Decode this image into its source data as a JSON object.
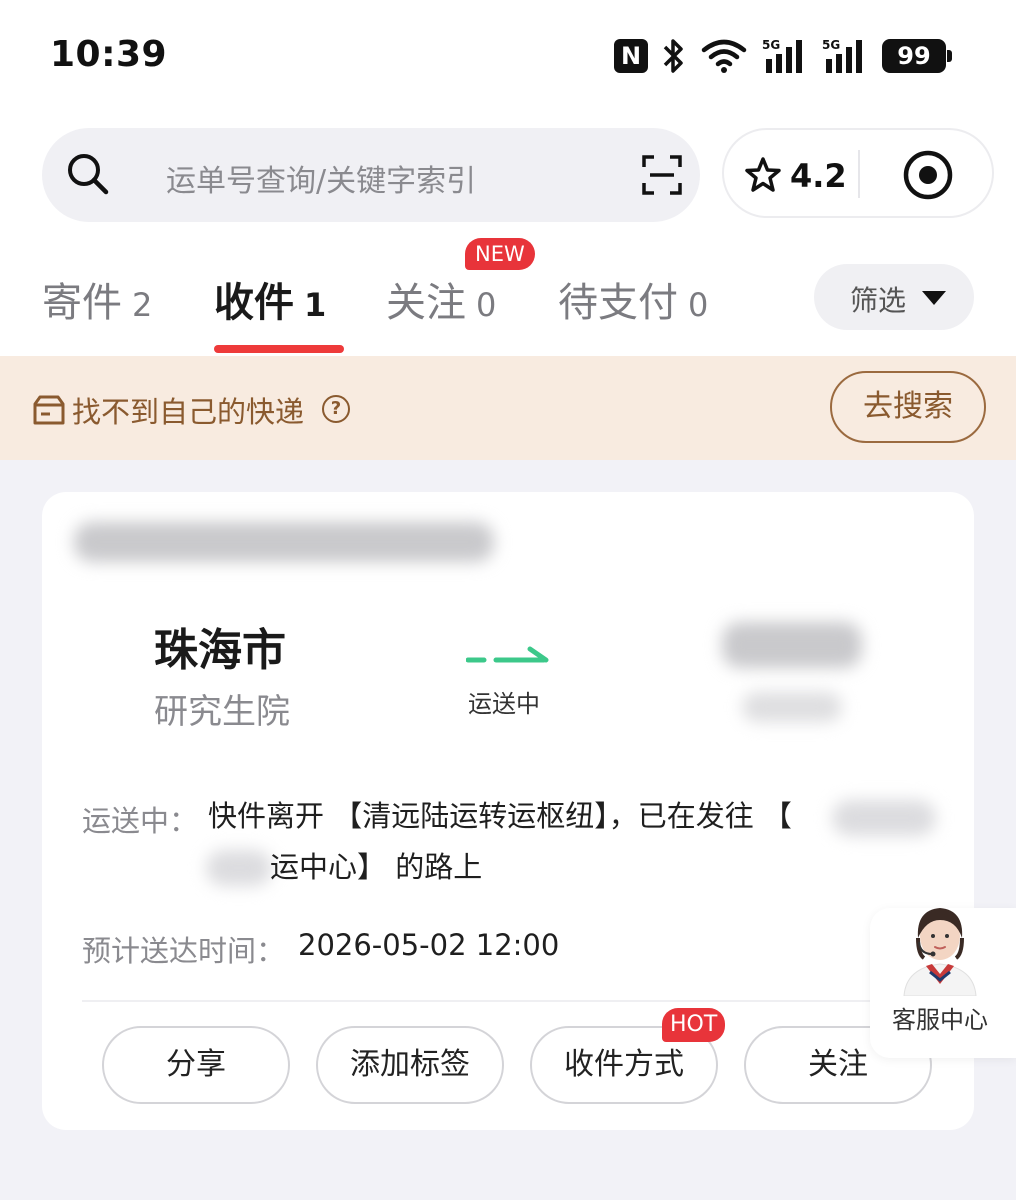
{
  "status_bar": {
    "time": "10:39",
    "battery": "99",
    "signal_label_1": "5G",
    "signal_label_2": "5G"
  },
  "search": {
    "placeholder": "运单号查询/关键字索引"
  },
  "rating": {
    "value": "4.2"
  },
  "tabs": [
    {
      "label": "寄件",
      "count": "2"
    },
    {
      "label": "收件",
      "count": "1"
    },
    {
      "label": "关注",
      "count": "0",
      "badge": "NEW"
    },
    {
      "label": "待支付",
      "count": "0"
    }
  ],
  "filter": {
    "label": "筛选"
  },
  "banner": {
    "text": "找不到自己的快递",
    "button": "去搜索"
  },
  "shipment": {
    "from_city": "珠海市",
    "from_place": "研究生院",
    "transit_status": "运送中",
    "status_prefix": "运送中：",
    "status_text_line1": "快件离开 【清远陆运转运枢纽】，已在发往 【",
    "status_text_line2": "运中心】 的路上",
    "eta_label": "预计送达时间：",
    "eta_value": "2026-05-02 12:00"
  },
  "actions": [
    {
      "label": "分享"
    },
    {
      "label": "添加标签"
    },
    {
      "label": "收件方式",
      "badge": "HOT"
    },
    {
      "label": "关注"
    }
  ],
  "customer_service": {
    "label": "客服中心"
  },
  "colors": {
    "accent_red": "#ee3a3a",
    "transit_green": "#3cc88a",
    "banner_brown": "#8a5a2f"
  }
}
